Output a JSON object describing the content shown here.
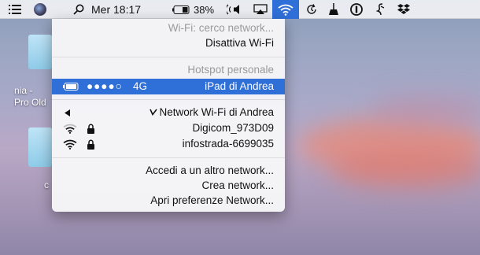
{
  "menubar": {
    "clock": "Mer 18:17",
    "battery_percent": "38%",
    "icons": [
      "list-icon",
      "siri-icon",
      "search-icon",
      "battery-icon",
      "volume-icon",
      "airplay-icon",
      "wifi-icon",
      "time-machine-icon",
      "broom-icon",
      "info-icon",
      "script-icon",
      "dropbox-icon"
    ]
  },
  "desktop": {
    "labels": [
      "nia -",
      "Pro Old",
      "c"
    ]
  },
  "wifi_menu": {
    "status": "Wi-Fi: cerco network...",
    "toggle": "Disattiva Wi-Fi",
    "hotspot_header": "Hotspot personale",
    "hotspot": {
      "name": "iPad di Andrea",
      "signal": "●●●●○",
      "network_type": "4G"
    },
    "networks_header": "Network Wi-Fi di Andrea",
    "networks": [
      {
        "name": "Digicom_973D09",
        "locked": true
      },
      {
        "name": "infostrada-6699035",
        "locked": true
      }
    ],
    "actions": [
      "Accedi a un altro network...",
      "Crea network...",
      "Apri preferenze Network..."
    ]
  },
  "colors": {
    "accent": "#2f6fd8",
    "menu_bg": "#f6f6f8"
  }
}
